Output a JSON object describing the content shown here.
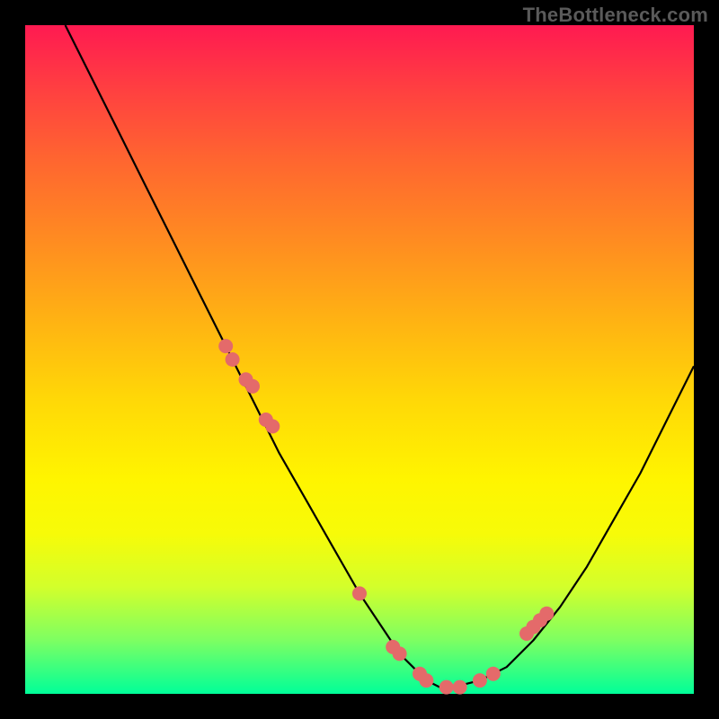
{
  "watermark": "TheBottleneck.com",
  "chart_data": {
    "type": "line",
    "title": "",
    "xlabel": "",
    "ylabel": "",
    "xlim": [
      0,
      100
    ],
    "ylim": [
      0,
      100
    ],
    "grid": false,
    "series": [
      {
        "name": "bottleneck-curve",
        "x": [
          6,
          10,
          14,
          18,
          22,
          26,
          30,
          34,
          38,
          42,
          46,
          50,
          54,
          56,
          58,
          60,
          62,
          64,
          68,
          72,
          76,
          80,
          84,
          88,
          92,
          96,
          100
        ],
        "values": [
          100,
          92,
          84,
          76,
          68,
          60,
          52,
          44,
          36,
          29,
          22,
          15,
          9,
          6,
          4,
          2,
          1,
          1,
          2,
          4,
          8,
          13,
          19,
          26,
          33,
          41,
          49
        ]
      }
    ],
    "markers": {
      "name": "highlight-dots",
      "color": "#e46a6a",
      "radius_px": 8,
      "x": [
        30,
        31,
        33,
        34,
        36,
        37,
        50,
        55,
        56,
        59,
        60,
        63,
        65,
        68,
        70,
        75,
        76,
        77,
        78
      ],
      "values": [
        52,
        50,
        47,
        46,
        41,
        40,
        15,
        7,
        6,
        3,
        2,
        1,
        1,
        2,
        3,
        9,
        10,
        11,
        12
      ]
    }
  }
}
